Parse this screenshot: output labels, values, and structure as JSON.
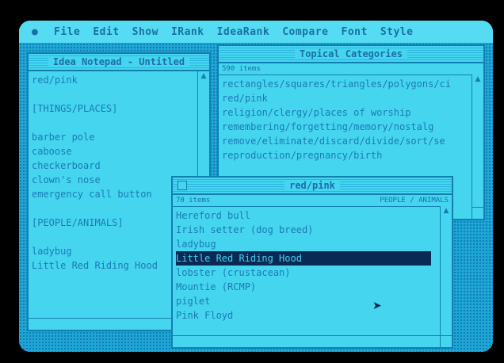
{
  "menubar": {
    "apple": "",
    "items": [
      "File",
      "Edit",
      "Show",
      "IRank",
      "IdeaRank",
      "Compare",
      "Font",
      "Style"
    ]
  },
  "notepad": {
    "title": "Idea Notepad - Untitled",
    "lines": [
      "red/pink",
      "",
      "[THINGS/PLACES]",
      "",
      "barber pole",
      "caboose",
      "checkerboard",
      "clown's nose",
      "emergency call button",
      "",
      "[PEOPLE/ANIMALS]",
      "",
      "ladybug",
      "Little Red Riding Hood"
    ]
  },
  "topical": {
    "title": "Topical Categories",
    "count": "590 items",
    "lines": [
      "rectangles/squares/triangles/polygons/ci",
      "red/pink",
      "religion/clergy/places of worship",
      "remembering/forgetting/memory/nostalg",
      "remove/eliminate/discard/divide/sort/se",
      "reproduction/pregnancy/birth"
    ]
  },
  "redpink": {
    "title": "red/pink",
    "count": "70 items",
    "category": "PEOPLE / ANIMALS",
    "lines": [
      "Hereford bull",
      "Irish setter (dog breed)",
      "ladybug",
      "Little Red Riding Hood",
      "lobster (crustacean)",
      "Mountie (RCMP)",
      "piglet",
      "Pink Floyd"
    ],
    "selected_index": 3
  },
  "colors": {
    "screen": "#3fd2ee",
    "text": "#1a7bb5",
    "selection": "#0a2a55"
  }
}
